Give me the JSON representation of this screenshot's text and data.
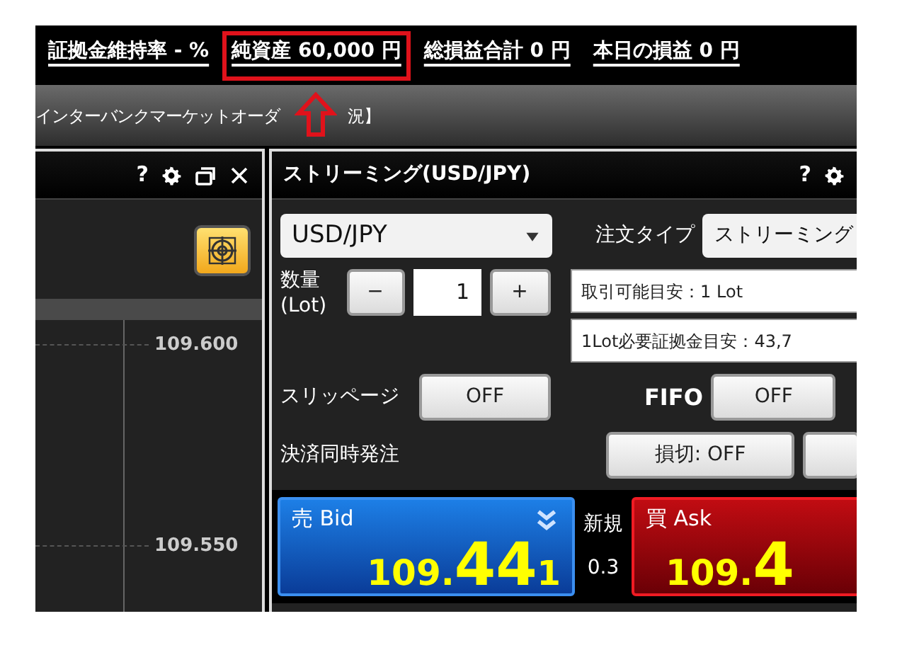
{
  "account_bar": {
    "items": [
      {
        "text": "証拠金維持率 - %",
        "highlighted": false
      },
      {
        "text": "純資産  60,000 円",
        "highlighted": true
      },
      {
        "text": "総損益合計 0 円",
        "highlighted": false
      },
      {
        "text": "本日の損益  0  円",
        "highlighted": false
      }
    ]
  },
  "menu_bar": {
    "title_parts": [
      "インターバンクマーケットオーダ",
      "況】"
    ]
  },
  "chart_panel": {
    "header_buttons": [
      "?"
    ],
    "axis_labels": [
      "109.600",
      "109.550"
    ]
  },
  "streaming_panel": {
    "title": "ストリーミング(USD/JPY)",
    "header_buttons": [
      "?"
    ],
    "pair_select": "USD/JPY",
    "order_type_label": "注文タイプ",
    "order_type": "ストリーミング",
    "quantity_label": "数量\n(Lot)",
    "minus": "−",
    "quantity": "1",
    "plus": "+",
    "info": [
      "取引可能目安：1 Lot",
      "1Lot必要証拠金目安：43,7"
    ],
    "slippage_label": "スリッページ",
    "slippage": "OFF",
    "fifo_label": "FIFO",
    "fifo": "OFF",
    "settle_label": "決済同時発注",
    "stop_loss": "損切: OFF",
    "bid": {
      "label": "売 Bid",
      "price_head": "109.",
      "price_big": "44",
      "price_tail": "1"
    },
    "spread_label": "新規",
    "spread": "0.3",
    "ask": {
      "label": "買 Ask",
      "price_head": "109.",
      "price_big": "4"
    }
  }
}
